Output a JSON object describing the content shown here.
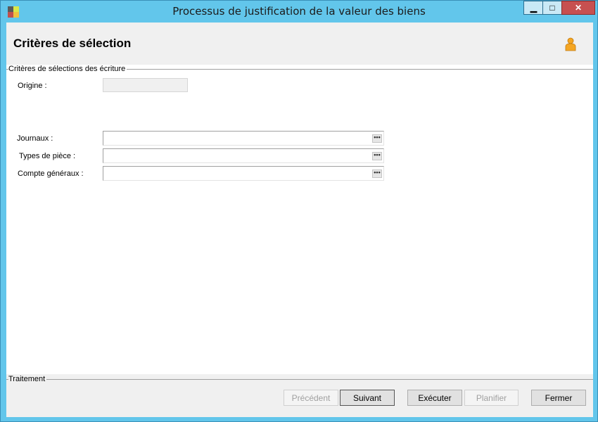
{
  "window": {
    "title": "Processus de justification de la valeur des biens",
    "minimize_glyph": "▁",
    "maximize_glyph": "□",
    "close_glyph": "✕"
  },
  "header": {
    "title": "Critères de sélection",
    "user_icon": "user-icon"
  },
  "selection_group": {
    "label": "Critères de sélections des écriture",
    "origine_label": "Origine :",
    "origine_value": "",
    "fields": [
      {
        "label": "Journaux :",
        "value": "",
        "button": "•••"
      },
      {
        "label": "Types de pièce :",
        "value": "",
        "button": "•••"
      },
      {
        "label": "Compte généraux :",
        "value": "",
        "button": "•••"
      }
    ]
  },
  "footer": {
    "group_label": "Traitement",
    "buttons": {
      "previous": "Précédent",
      "next": "Suivant",
      "execute": "Exécuter",
      "schedule": "Planifier",
      "close": "Fermer"
    }
  },
  "colors": {
    "title_bar": "#62c6eb",
    "close_button": "#c75050",
    "panel": "#f0f0f0"
  }
}
